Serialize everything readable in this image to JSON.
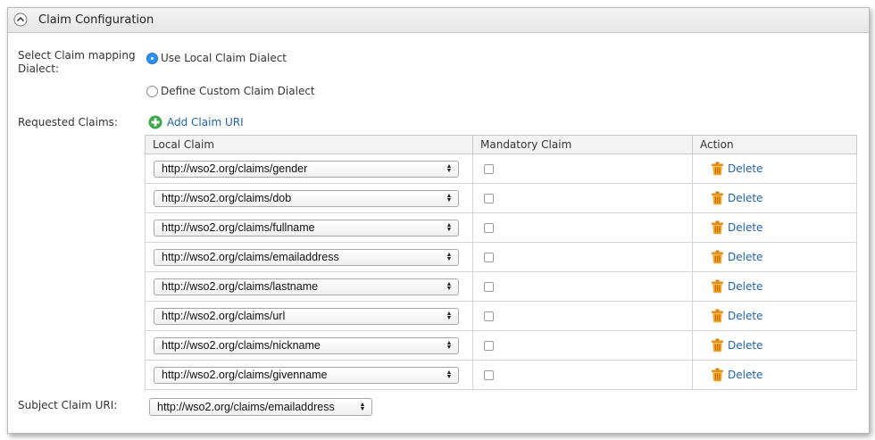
{
  "panel": {
    "title": "Claim Configuration"
  },
  "dialect": {
    "label_line1": "Select Claim mapping",
    "label_line2": "Dialect:",
    "options": [
      {
        "label": "Use Local Claim Dialect",
        "checked": true
      },
      {
        "label": "Define Custom Claim Dialect",
        "checked": false
      }
    ]
  },
  "requested_claims": {
    "label": "Requested Claims:",
    "add_label": "Add Claim URI",
    "headers": {
      "local_claim": "Local Claim",
      "mandatory": "Mandatory Claim",
      "action": "Action"
    },
    "delete_label": "Delete",
    "rows": [
      {
        "claim": "http://wso2.org/claims/gender",
        "mandatory": false
      },
      {
        "claim": "http://wso2.org/claims/dob",
        "mandatory": false
      },
      {
        "claim": "http://wso2.org/claims/fullname",
        "mandatory": false
      },
      {
        "claim": "http://wso2.org/claims/emailaddress",
        "mandatory": false
      },
      {
        "claim": "http://wso2.org/claims/lastname",
        "mandatory": false
      },
      {
        "claim": "http://wso2.org/claims/url",
        "mandatory": false
      },
      {
        "claim": "http://wso2.org/claims/nickname",
        "mandatory": false
      },
      {
        "claim": "http://wso2.org/claims/givenname",
        "mandatory": false
      }
    ]
  },
  "subject": {
    "label": "Subject Claim URI:",
    "value": "http://wso2.org/claims/emailaddress"
  },
  "colors": {
    "link": "#2065a7",
    "radio_selected": "#2e8ff5",
    "add_icon": "#3aa845",
    "trash_icon": "#f0a020"
  }
}
